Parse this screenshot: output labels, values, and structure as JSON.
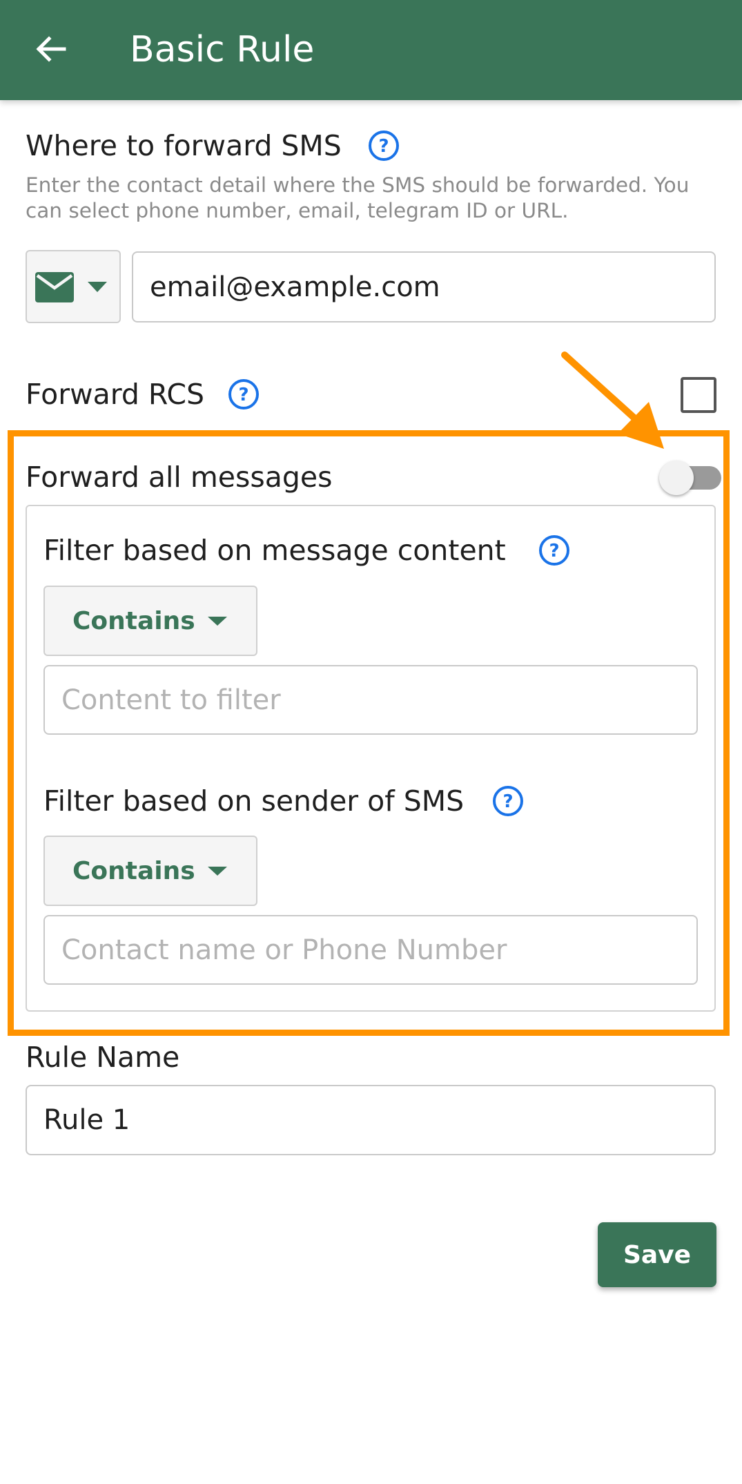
{
  "app_bar": {
    "title": "Basic Rule",
    "back_icon": "arrow-back-icon",
    "color": "#3a7558"
  },
  "destination": {
    "title": "Where to forward SMS",
    "description": "Enter the contact detail where the SMS should be forwarded. You can select phone number, email, telegram ID or URL.",
    "type_icon": "email-icon",
    "value": "email@example.com"
  },
  "forward_rcs": {
    "label": "Forward RCS",
    "checked": false
  },
  "forward_all": {
    "label": "Forward all messages",
    "enabled": false
  },
  "content_filter": {
    "title": "Filter based on message content",
    "operator": "Contains",
    "placeholder": "Content to filter"
  },
  "sender_filter": {
    "title": "Filter based on sender of SMS",
    "operator": "Contains",
    "placeholder": "Contact name or Phone Number"
  },
  "rule_name": {
    "label": "Rule Name",
    "value": "Rule 1"
  },
  "save_label": "Save",
  "colors": {
    "accent": "#3a7558",
    "help": "#1a73e8",
    "highlight": "#ff9300"
  }
}
